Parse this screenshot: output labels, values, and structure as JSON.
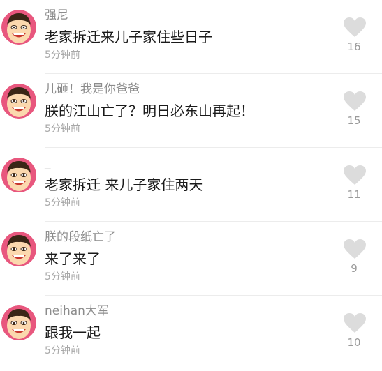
{
  "comments": [
    {
      "username": "强尼",
      "text": "老家拆迁来儿子家住些日子",
      "time": "5分钟前",
      "likes": "16",
      "avatar_icon": "cartoon-face-icon",
      "like_icon": "heart-icon"
    },
    {
      "username": "儿砸！我是你爸爸",
      "text": "朕的江山亡了？明日必东山再起！",
      "time": "5分钟前",
      "likes": "15",
      "avatar_icon": "cartoon-face-icon",
      "like_icon": "heart-icon"
    },
    {
      "username": "_",
      "text": "老家拆迁 来儿子家住两天",
      "time": "5分钟前",
      "likes": "11",
      "avatar_icon": "cartoon-face-icon",
      "like_icon": "heart-icon"
    },
    {
      "username": "朕的段纸亡了",
      "text": "来了来了",
      "time": "5分钟前",
      "likes": "9",
      "avatar_icon": "cartoon-face-icon",
      "like_icon": "heart-icon"
    },
    {
      "username": "neihan大军",
      "text": "跟我一起",
      "time": "5分钟前",
      "likes": "10",
      "avatar_icon": "cartoon-face-icon",
      "like_icon": "heart-icon"
    }
  ],
  "colors": {
    "avatar_bg": "#e8577e",
    "face": "#fbd8ae",
    "hair": "#3a2616",
    "heart": "#dcdcdc",
    "divider": "#ececec"
  }
}
